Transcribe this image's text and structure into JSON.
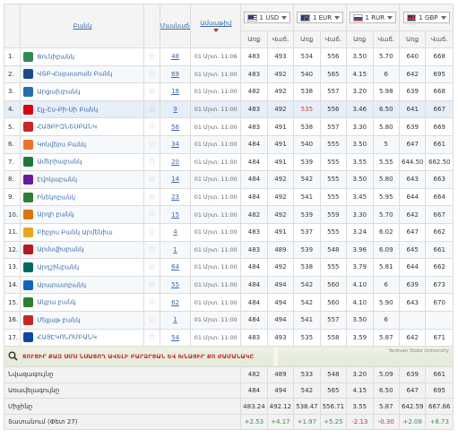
{
  "header": {
    "bank": "Բանկ",
    "branches": "Մասնաճյուղեր",
    "date": "Ամսաթիվ",
    "buy": "Առք",
    "sell": "Վաճ."
  },
  "currencies": [
    {
      "flag": "usd",
      "label": "1 USD"
    },
    {
      "flag": "eur",
      "label": "1 EUR"
    },
    {
      "flag": "rur",
      "label": "1 RUR"
    },
    {
      "flag": "gbp",
      "label": "1 GBP"
    }
  ],
  "rows": [
    {
      "num": "1.",
      "name": "Ցունիբանկ",
      "logo_color": "#2e8b57",
      "branches": "48",
      "date": "01 Մրտ. 11:06",
      "usd_buy": "483",
      "usd_sell": "493",
      "eur_buy": "534",
      "eur_sell": "556",
      "rur_buy": "3.50",
      "rur_sell": "5.70",
      "gbp_buy": "640",
      "gbp_sell": "668"
    },
    {
      "num": "2.",
      "name": "ՎՏԲ-Հայաստան Բանկ",
      "logo_color": "#1a4a8a",
      "branches": "69",
      "date": "01 Մրտ. 11:00",
      "usd_buy": "483",
      "usd_sell": "492",
      "eur_buy": "540",
      "eur_sell": "565",
      "rur_buy": "4.15",
      "rur_sell": "6",
      "gbp_buy": "642",
      "gbp_sell": "695"
    },
    {
      "num": "3.",
      "name": "Արցախբանկ",
      "logo_color": "#2b6cb0",
      "branches": "18",
      "date": "01 Մրտ. 11:00",
      "usd_buy": "482",
      "usd_sell": "492",
      "eur_buy": "538",
      "eur_sell": "557",
      "rur_buy": "3.20",
      "rur_sell": "5.98",
      "gbp_buy": "639",
      "gbp_sell": "668"
    },
    {
      "num": "4.",
      "name": "Էյչ-Էս-Բի-Սի Բանկ",
      "logo_color": "#db0011",
      "branches": "9",
      "date": "01 Մրտ. 11:00",
      "usd_buy": "483",
      "usd_sell": "492",
      "eur_buy": "535",
      "eur_sell": "556",
      "rur_buy": "3.46",
      "rur_sell": "6.50",
      "gbp_buy": "641",
      "gbp_sell": "667"
    },
    {
      "num": "5.",
      "name": "ՀԱՅԲԻԶՆԵՍԲԱՆԿ",
      "logo_color": "#c62828",
      "branches": "56",
      "date": "01 Մրտ. 11:00",
      "usd_buy": "483",
      "usd_sell": "491",
      "eur_buy": "538",
      "eur_sell": "557",
      "rur_buy": "3.30",
      "rur_sell": "5.80",
      "gbp_buy": "639",
      "gbp_sell": "669"
    },
    {
      "num": "6.",
      "name": "Կոնվերս Բանկ",
      "logo_color": "#e8742a",
      "branches": "34",
      "date": "01 Մրտ. 11:00",
      "usd_buy": "484",
      "usd_sell": "491",
      "eur_buy": "540",
      "eur_sell": "555",
      "rur_buy": "3.50",
      "rur_sell": "5",
      "gbp_buy": "647",
      "gbp_sell": "661"
    },
    {
      "num": "7.",
      "name": "Ամերիաբանկ",
      "logo_color": "#1e7a3a",
      "branches": "20",
      "date": "01 Մրտ. 11:00",
      "usd_buy": "484",
      "usd_sell": "491",
      "eur_buy": "539",
      "eur_sell": "555",
      "rur_buy": "3.55",
      "rur_sell": "5.55",
      "gbp_buy": "644.50",
      "gbp_sell": "662.50"
    },
    {
      "num": "8.",
      "name": "Էվոկաբանկ",
      "logo_color": "#6a1b9a",
      "branches": "14",
      "date": "01 Մրտ. 11:00",
      "usd_buy": "484",
      "usd_sell": "492",
      "eur_buy": "542",
      "eur_sell": "555",
      "rur_buy": "3.50",
      "rur_sell": "5.80",
      "gbp_buy": "643",
      "gbp_sell": "663"
    },
    {
      "num": "9.",
      "name": "Ինեկոբանկ",
      "logo_color": "#2e7d32",
      "branches": "23",
      "date": "01 Մրտ. 11:00",
      "usd_buy": "484",
      "usd_sell": "492",
      "eur_buy": "541",
      "eur_sell": "555",
      "rur_buy": "3.45",
      "rur_sell": "5.95",
      "gbp_buy": "644",
      "gbp_sell": "664"
    },
    {
      "num": "10.",
      "name": "Արդի բանկ",
      "logo_color": "#d97706",
      "branches": "15",
      "date": "01 Մրտ. 11:00",
      "usd_buy": "482",
      "usd_sell": "492",
      "eur_buy": "539",
      "eur_sell": "559",
      "rur_buy": "3.30",
      "rur_sell": "5.70",
      "gbp_buy": "642",
      "gbp_sell": "667"
    },
    {
      "num": "11.",
      "name": "Բիբլոս Բանկ Արմենիա",
      "logo_color": "#e6a817",
      "branches": "4",
      "date": "01 Մրտ. 11:00",
      "usd_buy": "483",
      "usd_sell": "491",
      "eur_buy": "537",
      "eur_sell": "555",
      "rur_buy": "3.24",
      "rur_sell": "6.02",
      "gbp_buy": "647",
      "gbp_sell": "662"
    },
    {
      "num": "12.",
      "name": "Արմսվիսբանկ",
      "logo_color": "#b71c1c",
      "branches": "1",
      "date": "01 Մրտ. 11:00",
      "usd_buy": "483",
      "usd_sell": "489",
      "eur_buy": "539",
      "eur_sell": "548",
      "rur_buy": "3.96",
      "rur_sell": "6.09",
      "gbp_buy": "645",
      "gbp_sell": "661"
    },
    {
      "num": "13.",
      "name": "Արդշինբանկ",
      "logo_color": "#00695c",
      "branches": "64",
      "date": "01 Մրտ. 11:00",
      "usd_buy": "484",
      "usd_sell": "492",
      "eur_buy": "538",
      "eur_sell": "555",
      "rur_buy": "3.79",
      "rur_sell": "5.81",
      "gbp_buy": "644",
      "gbp_sell": "662"
    },
    {
      "num": "14.",
      "name": "Արարատբանկ",
      "logo_color": "#1565c0",
      "branches": "55",
      "date": "01 Մրտ. 11:00",
      "usd_buy": "484",
      "usd_sell": "494",
      "eur_buy": "542",
      "eur_sell": "560",
      "rur_buy": "4.10",
      "rur_sell": "6",
      "gbp_buy": "639",
      "gbp_sell": "673"
    },
    {
      "num": "15.",
      "name": "Ակբա բանկ",
      "logo_color": "#2e7d32",
      "branches": "62",
      "date": "01 Մրտ. 11:00",
      "usd_buy": "484",
      "usd_sell": "494",
      "eur_buy": "542",
      "eur_sell": "560",
      "rur_buy": "4.10",
      "rur_sell": "5.90",
      "gbp_buy": "643",
      "gbp_sell": "670"
    },
    {
      "num": "16.",
      "name": "Մելլաթ բանկ",
      "logo_color": "#c62828",
      "branches": "1",
      "date": "01 Մրտ. 11:00",
      "usd_buy": "484",
      "usd_sell": "494",
      "eur_buy": "541",
      "eur_sell": "557",
      "rur_buy": "3.50",
      "rur_sell": "6",
      "gbp_buy": "",
      "gbp_sell": ""
    },
    {
      "num": "17.",
      "name": "ՀԱՅԷԿՈՆՈՄԲԱՆԿ",
      "logo_color": "#0d47a1",
      "branches": "54",
      "date": "01 Մրտ. 11:00",
      "usd_buy": "483",
      "usd_sell": "493",
      "eur_buy": "535",
      "eur_sell": "558",
      "rur_buy": "3.59",
      "rur_sell": "5.87",
      "gbp_buy": "642",
      "gbp_sell": "671"
    }
  ],
  "map_banner": {
    "text": "ՑՈՒՑԻՐ ՔԱԶ ՍՄՍ ՆՍԱՑՈՂ ԱՎԵԼԻ ԲԱՐՁՐՅԱՆ ԵՎ ԽՆԱՅԻՐ ՔՈ ԺԱՄԱՆԱԿԸ",
    "map_label": "Yerevan State University"
  },
  "stats": [
    {
      "label": "Նվազագույնը",
      "vals": [
        "482",
        "489",
        "533",
        "548",
        "3.20",
        "5.09",
        "639",
        "661"
      ],
      "color": ""
    },
    {
      "label": "Առավելագույնը",
      "vals": [
        "484",
        "494",
        "542",
        "565",
        "4.15",
        "6.50",
        "647",
        "695"
      ],
      "color": ""
    },
    {
      "label": "Միջինը",
      "vals": [
        "483.24",
        "492.12",
        "538.47",
        "556.71",
        "3.55",
        "5.87",
        "642.59",
        "667.66"
      ],
      "color": ""
    },
    {
      "label": "Տատանում (Փետ 27)",
      "vals": [
        "+2.53",
        "+4.17",
        "+1.97",
        "+5.25",
        "-2.13",
        "-0.30",
        "+2.08",
        "+8.73"
      ],
      "color": "change"
    }
  ],
  "highlight_rate": "535",
  "colors": {
    "link": "#3b6aa8",
    "accent_red": "#e0342c",
    "green": "#2e9b3a"
  }
}
